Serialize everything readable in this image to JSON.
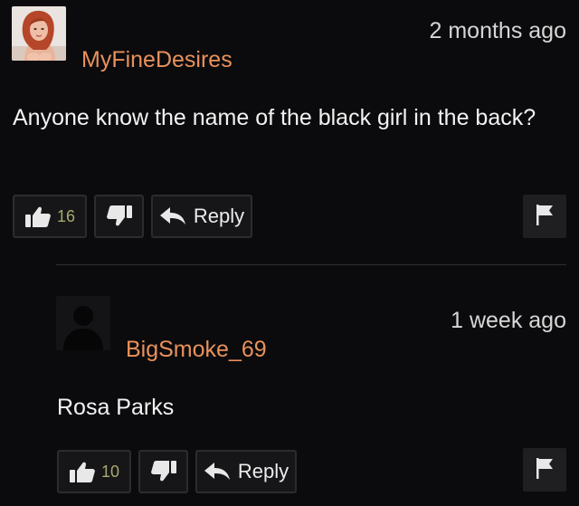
{
  "comments": [
    {
      "username": "MyFineDesires",
      "timestamp": "2 months ago",
      "text": "Anyone know the name of the black girl in the back?",
      "likes": "16",
      "reply_label": "Reply",
      "avatar_icon": "user-photo-avatar"
    },
    {
      "username": "BigSmoke_69",
      "timestamp": "1 week ago",
      "text": "Rosa Parks",
      "likes": "10",
      "reply_label": "Reply",
      "avatar_icon": "default-silhouette-avatar"
    }
  ],
  "icons": {
    "like": "thumbs-up-icon",
    "dislike": "thumbs-down-icon",
    "reply": "reply-arrow-icon",
    "flag": "flag-icon"
  },
  "colors": {
    "background": "#0b0b0d",
    "username": "#e9915c",
    "text": "#f2f2f2",
    "timestamp": "#d6d6d6",
    "like_count": "#a8a870",
    "button_bg": "#161618",
    "button_border": "#2c2c2e"
  }
}
